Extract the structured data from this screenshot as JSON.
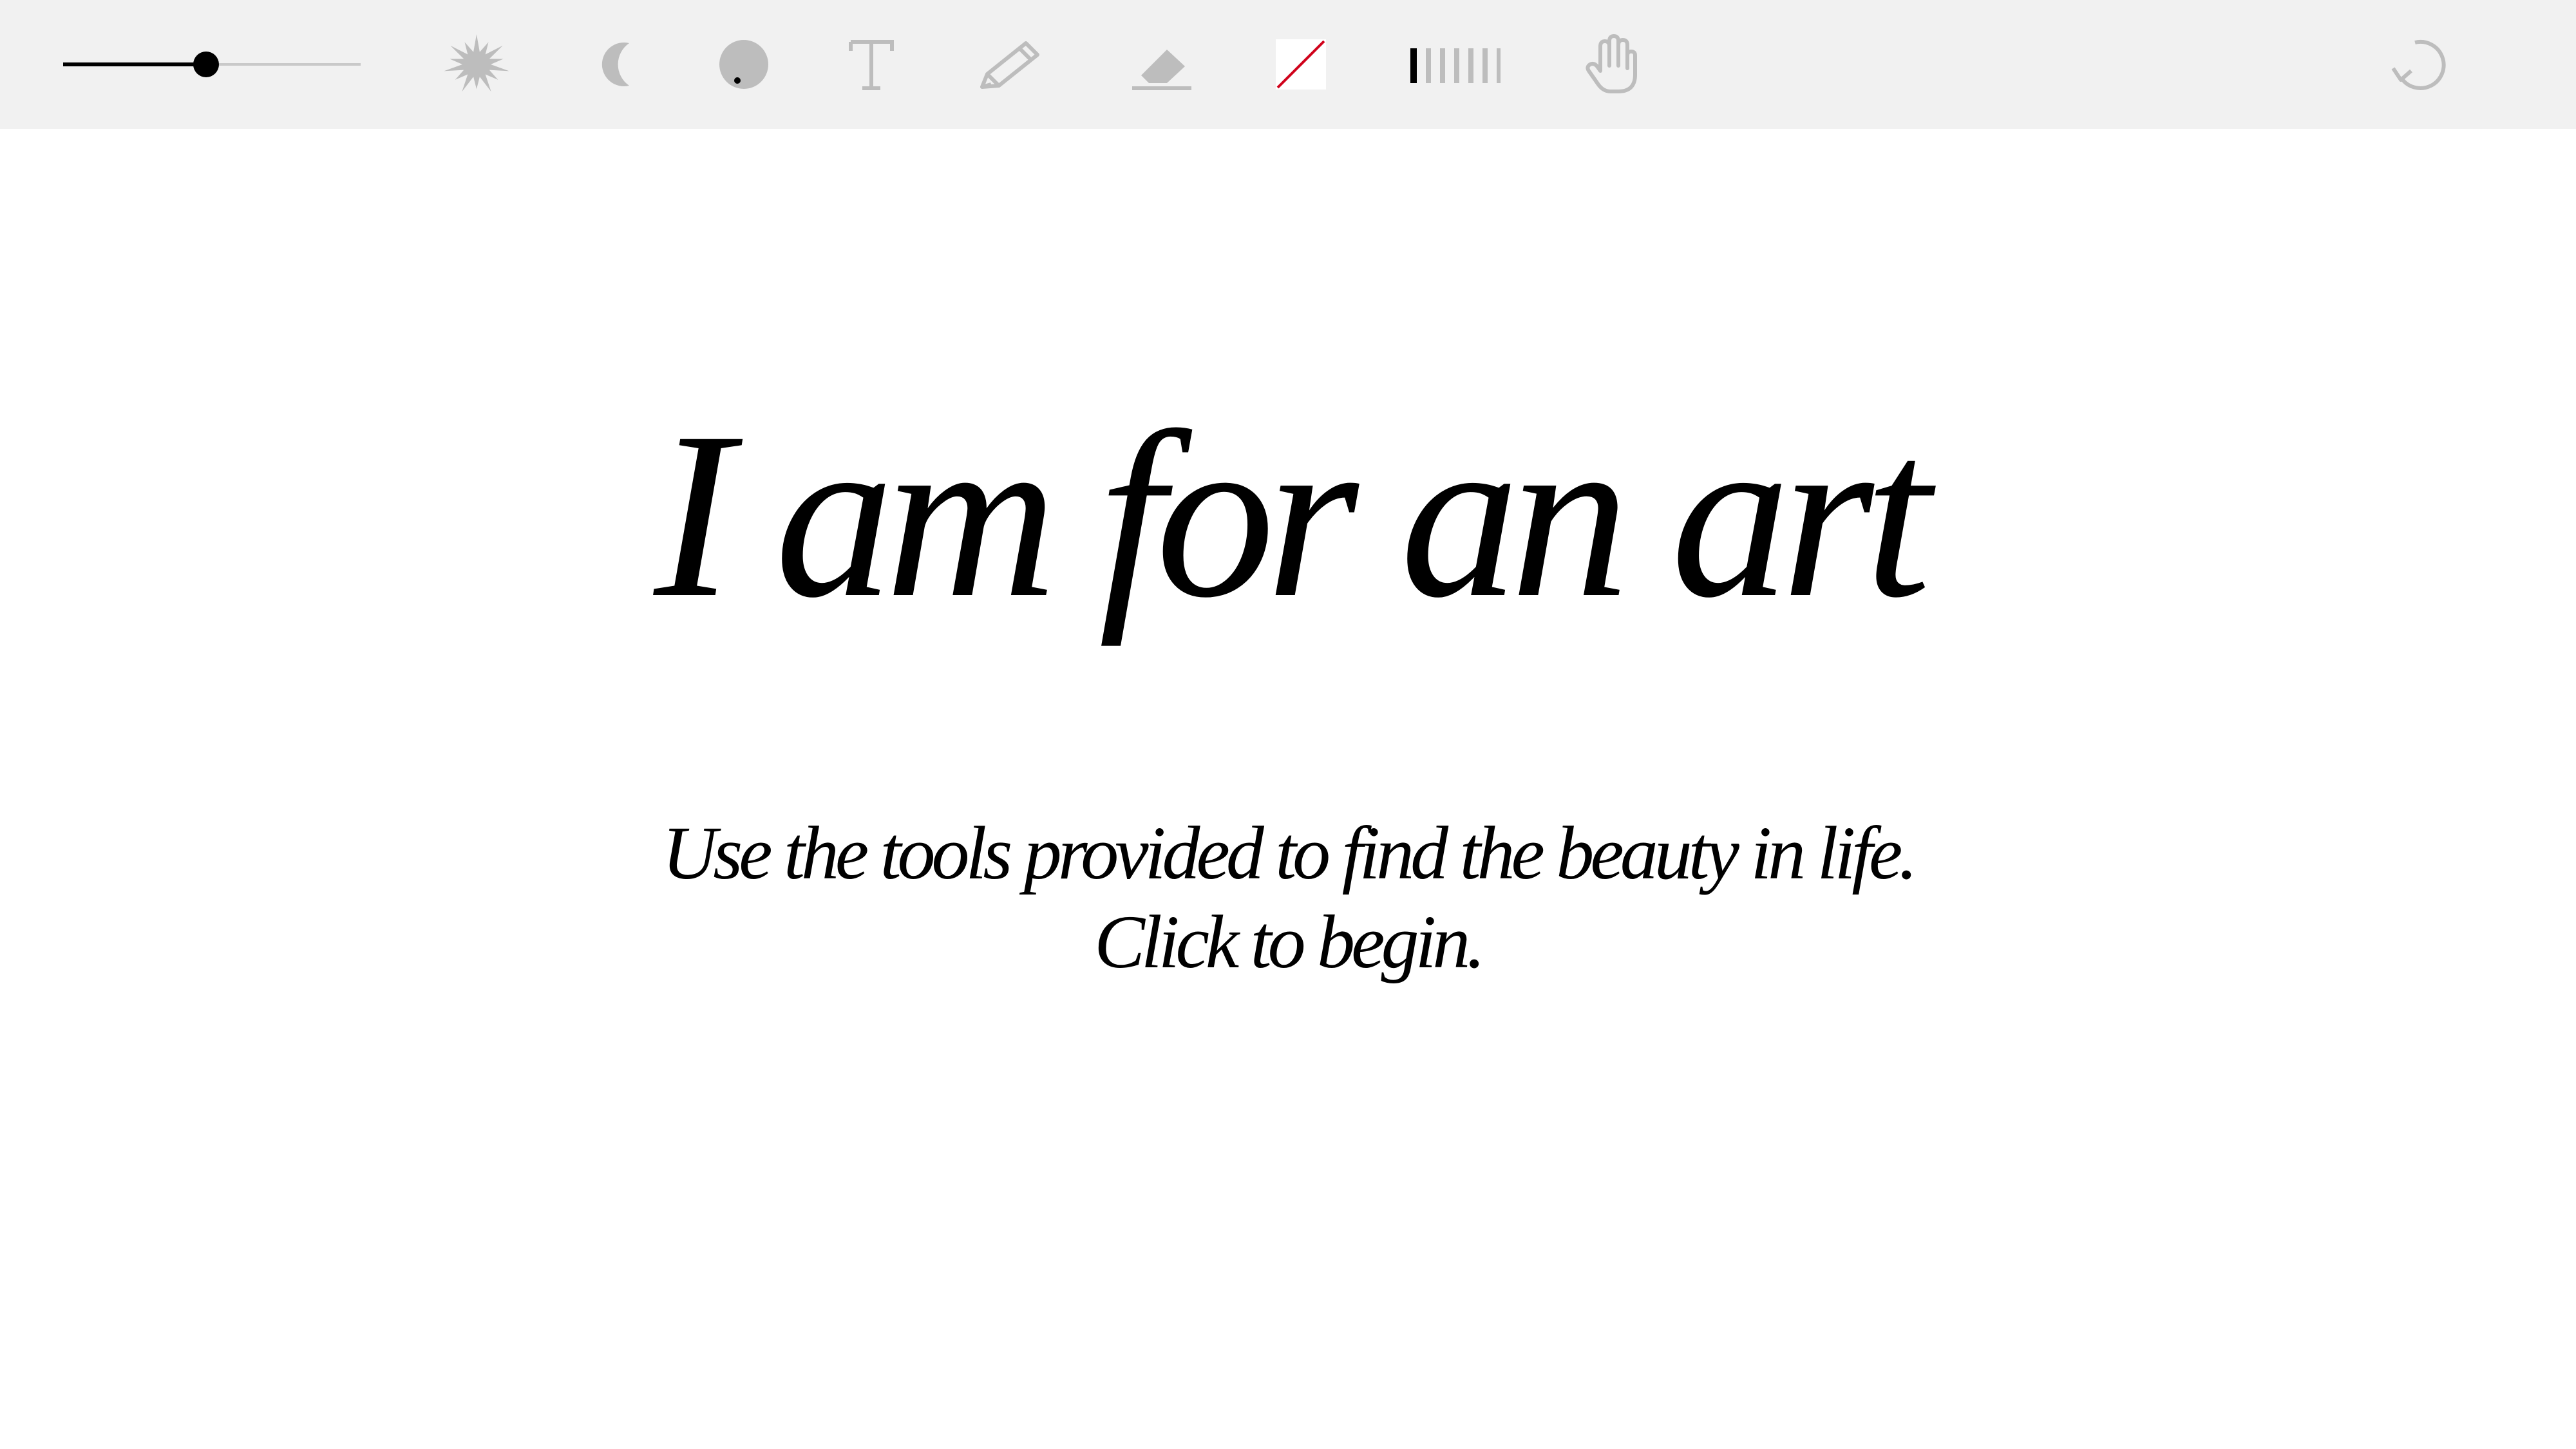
{
  "toolbar": {
    "brush_size": {
      "value": 0.48,
      "min": 0,
      "max": 1
    },
    "tools": [
      {
        "id": "burst",
        "icon": "starburst-icon"
      },
      {
        "id": "moon",
        "icon": "crescent-moon-icon"
      },
      {
        "id": "dot",
        "icon": "circle-brush-icon"
      },
      {
        "id": "text",
        "icon": "text-icon",
        "glyph": "T"
      },
      {
        "id": "pencil",
        "icon": "pencil-icon"
      },
      {
        "id": "eraser",
        "icon": "eraser-icon"
      },
      {
        "id": "color",
        "icon": "no-color-swatch-icon"
      },
      {
        "id": "lines",
        "icon": "line-pattern-icon"
      },
      {
        "id": "hand",
        "icon": "hand-icon"
      },
      {
        "id": "undo",
        "icon": "undo-icon"
      }
    ],
    "colors": {
      "background": "#f1f1f1",
      "icon": "#bdbdbd",
      "accent": "#d0021b",
      "active": "#000000"
    }
  },
  "canvas": {
    "headline": "I am for an art",
    "subline_1": "Use the tools provided to find the beauty in life.",
    "subline_2": "Click to begin."
  }
}
